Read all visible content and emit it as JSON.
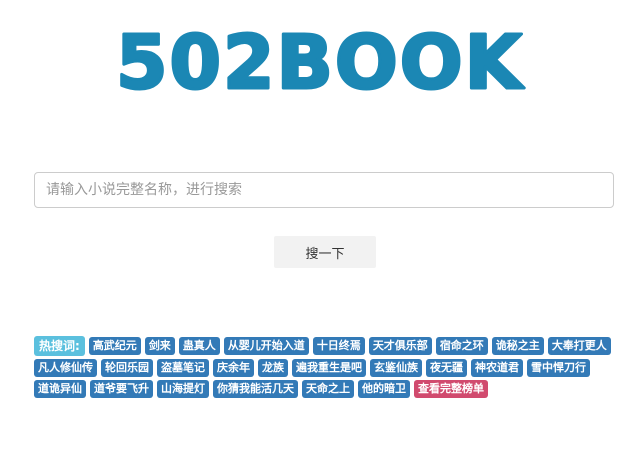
{
  "logo": {
    "text": "502BOOK",
    "color": "#1b87b4"
  },
  "search": {
    "placeholder": "请输入小说完整名称，进行搜索",
    "value": "",
    "button_label": "搜一下"
  },
  "hot_search": {
    "label": "热搜词:",
    "label_color": "#5bc0de",
    "tag_color": "#337ab7",
    "tags": [
      "高武纪元",
      "剑来",
      "蛊真人",
      "从婴儿开始入道",
      "十日终焉",
      "天才俱乐部",
      "宿命之环",
      "诡秘之主",
      "大奉打更人",
      "凡人修仙传",
      "轮回乐园",
      "盗墓笔记",
      "庆余年",
      "龙族",
      "遍我重生是吧",
      "玄鉴仙族",
      "夜无疆",
      "神农道君",
      "雪中悍刀行",
      "道诡异仙",
      "道爷要飞升",
      "山海提灯",
      "你猜我能活几天",
      "天命之上",
      "他的暗卫"
    ],
    "more_label": "查看完整榜单",
    "more_color": "#d14a6e"
  }
}
